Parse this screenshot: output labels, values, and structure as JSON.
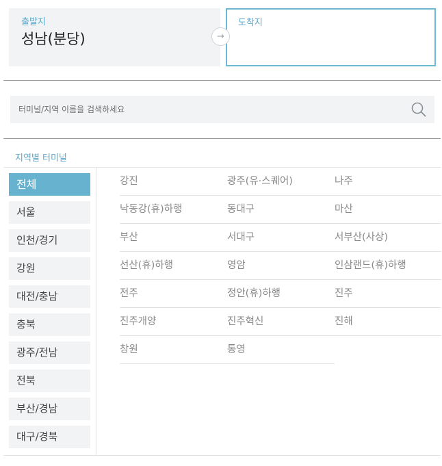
{
  "route": {
    "departure_label": "출발지",
    "departure_value": "성남(분당)",
    "arrival_label": "도착지",
    "arrival_value": "",
    "swap_icon": "arrow-right-icon"
  },
  "search": {
    "placeholder": "터미널/지역 이름을 검색하세요",
    "value": "",
    "icon": "search-icon"
  },
  "section": {
    "title": "지역별 터미널"
  },
  "regions": [
    {
      "label": "전체",
      "active": true
    },
    {
      "label": "서울",
      "active": false
    },
    {
      "label": "인천/경기",
      "active": false
    },
    {
      "label": "강원",
      "active": false
    },
    {
      "label": "대전/충남",
      "active": false
    },
    {
      "label": "충북",
      "active": false
    },
    {
      "label": "광주/전남",
      "active": false
    },
    {
      "label": "전북",
      "active": false
    },
    {
      "label": "부산/경남",
      "active": false
    },
    {
      "label": "대구/경북",
      "active": false
    }
  ],
  "terminals": [
    "강진",
    "광주(유·스퀘어)",
    "나주",
    "낙동강(휴)하행",
    "동대구",
    "마산",
    "부산",
    "서대구",
    "서부산(사상)",
    "선산(휴)하행",
    "영암",
    "인삼랜드(휴)하행",
    "전주",
    "정안(휴)하행",
    "진주",
    "진주개양",
    "진주혁신",
    "진해",
    "창원",
    "통영"
  ],
  "colors": {
    "accent": "#5ba7c9",
    "active_region_bg": "#67b3cf",
    "arrival_border": "#6db8d3",
    "panel_bg": "#f2f3f5"
  }
}
